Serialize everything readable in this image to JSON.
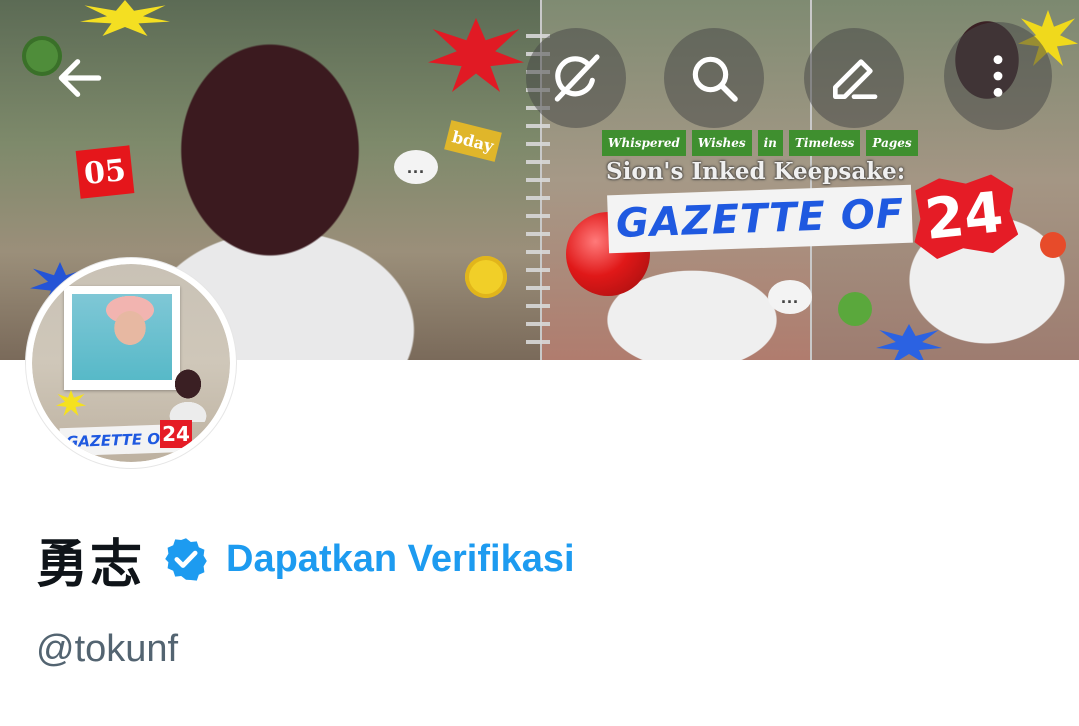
{
  "header": {
    "banner": {
      "tag_number": "05",
      "bday_label": "bday",
      "bubble_text": "...",
      "gazette_words": [
        "Whispered",
        "Wishes",
        "in",
        "Timeless",
        "Pages"
      ],
      "gazette_subtitle": "Sion's Inked Keepsake:",
      "gazette_title": "GAZETTE OF",
      "gazette_number": "24"
    },
    "buttons": {
      "back_icon": "arrow-left-icon",
      "grok_icon": "grok-icon",
      "search_icon": "search-icon",
      "edit_icon": "pencil-icon",
      "more_icon": "more-vertical-icon"
    }
  },
  "avatar": {
    "label": "GAZETTE OF",
    "number": "24",
    "icon": "profile-avatar"
  },
  "profile": {
    "display_name": "勇志",
    "verified_icon": "verified-badge-icon",
    "get_verified_label": "Dapatkan Verifikasi",
    "handle": "@tokunf"
  },
  "colors": {
    "accent": "#1d9bf0",
    "text_primary": "#0f1419",
    "text_secondary": "#536471",
    "overlay_button": "#464646"
  }
}
